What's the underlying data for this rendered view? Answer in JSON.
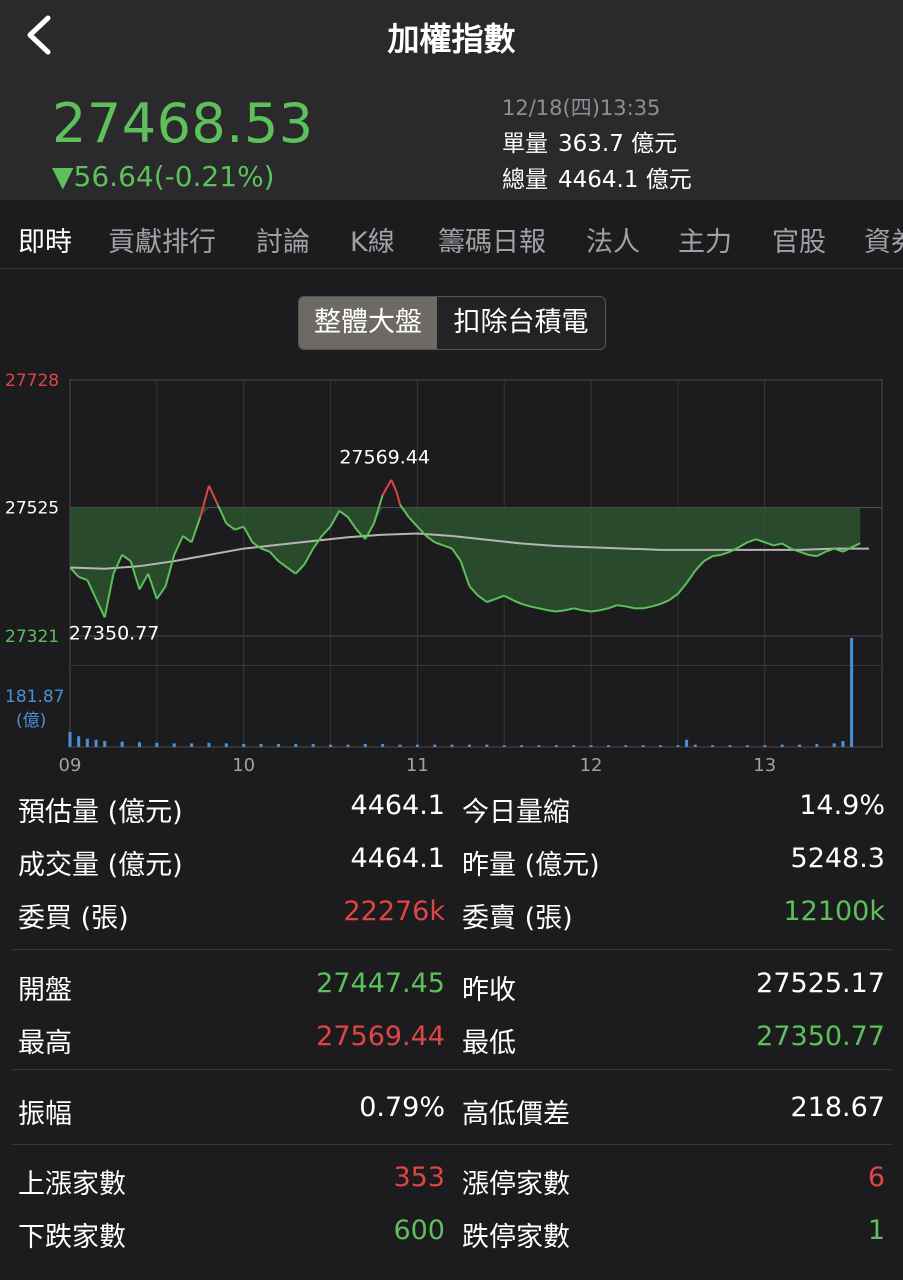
{
  "header": {
    "title": "加權指數",
    "price": "27468.53",
    "change": "▼56.64(-0.21%)",
    "datetime": "12/18(四)13:35",
    "single_volume_label": "單量",
    "single_volume_value": "363.7 億元",
    "total_volume_label": "總量",
    "total_volume_value": "4464.1 億元"
  },
  "tabs": [
    "即時",
    "貢獻排行",
    "討論",
    "K線",
    "籌碼日報",
    "法人",
    "主力",
    "官股",
    "資券"
  ],
  "segment": {
    "options": [
      "整體大盤",
      "扣除台積電"
    ],
    "selected": 0
  },
  "colors": {
    "up": "#e04545",
    "down": "#5dc05b",
    "volume": "#4a90d9",
    "avg": "#b5b5b5"
  },
  "chart_data": {
    "type": "line",
    "y_labels": {
      "top": "27728",
      "mid": "27525",
      "bottom": "27321"
    },
    "ylim": [
      27321,
      27728
    ],
    "prev_close": 27525.17,
    "high_annotation": "27569.44",
    "low_annotation": "27350.77",
    "volume_max_label": "181.87",
    "volume_unit": "(億)",
    "volume_max": 181.87,
    "x_ticks": [
      "09",
      "10",
      "11",
      "12",
      "13"
    ],
    "x_tick_hours": [
      9,
      10,
      11,
      12,
      13
    ],
    "series": [
      {
        "values": [
          [
            9.0,
            27430
          ],
          [
            9.05,
            27415
          ],
          [
            9.1,
            27410
          ],
          [
            9.15,
            27380
          ],
          [
            9.2,
            27350.77
          ],
          [
            9.25,
            27420
          ],
          [
            9.3,
            27450
          ],
          [
            9.35,
            27440
          ],
          [
            9.4,
            27395
          ],
          [
            9.45,
            27420
          ],
          [
            9.5,
            27380
          ],
          [
            9.55,
            27400
          ],
          [
            9.6,
            27450
          ],
          [
            9.65,
            27480
          ],
          [
            9.7,
            27470
          ],
          [
            9.75,
            27510
          ],
          [
            9.8,
            27560
          ],
          [
            9.85,
            27530
          ],
          [
            9.9,
            27500
          ],
          [
            9.95,
            27490
          ],
          [
            10.0,
            27495
          ],
          [
            10.05,
            27470
          ],
          [
            10.1,
            27460
          ],
          [
            10.15,
            27455
          ],
          [
            10.2,
            27440
          ],
          [
            10.25,
            27430
          ],
          [
            10.3,
            27420
          ],
          [
            10.35,
            27435
          ],
          [
            10.4,
            27460
          ],
          [
            10.45,
            27480
          ],
          [
            10.5,
            27495
          ],
          [
            10.55,
            27520
          ],
          [
            10.6,
            27510
          ],
          [
            10.65,
            27490
          ],
          [
            10.7,
            27475
          ],
          [
            10.75,
            27500
          ],
          [
            10.8,
            27545
          ],
          [
            10.85,
            27569.44
          ],
          [
            10.88,
            27550
          ],
          [
            10.9,
            27530
          ],
          [
            10.95,
            27510
          ],
          [
            11.0,
            27495
          ],
          [
            11.05,
            27480
          ],
          [
            11.1,
            27470
          ],
          [
            11.15,
            27465
          ],
          [
            11.2,
            27460
          ],
          [
            11.25,
            27440
          ],
          [
            11.3,
            27400
          ],
          [
            11.35,
            27385
          ],
          [
            11.4,
            27375
          ],
          [
            11.45,
            27380
          ],
          [
            11.5,
            27385
          ],
          [
            11.55,
            27378
          ],
          [
            11.6,
            27372
          ],
          [
            11.65,
            27368
          ],
          [
            11.7,
            27365
          ],
          [
            11.75,
            27362
          ],
          [
            11.8,
            27360
          ],
          [
            11.85,
            27362
          ],
          [
            11.9,
            27365
          ],
          [
            11.95,
            27362
          ],
          [
            12.0,
            27360
          ],
          [
            12.05,
            27362
          ],
          [
            12.1,
            27365
          ],
          [
            12.15,
            27370
          ],
          [
            12.2,
            27368
          ],
          [
            12.25,
            27365
          ],
          [
            12.3,
            27365
          ],
          [
            12.35,
            27368
          ],
          [
            12.4,
            27372
          ],
          [
            12.45,
            27378
          ],
          [
            12.5,
            27388
          ],
          [
            12.55,
            27405
          ],
          [
            12.6,
            27425
          ],
          [
            12.65,
            27440
          ],
          [
            12.7,
            27448
          ],
          [
            12.75,
            27450
          ],
          [
            12.8,
            27455
          ],
          [
            12.85,
            27462
          ],
          [
            12.9,
            27470
          ],
          [
            12.95,
            27475
          ],
          [
            13.0,
            27470
          ],
          [
            13.05,
            27465
          ],
          [
            13.1,
            27468
          ],
          [
            13.15,
            27460
          ],
          [
            13.2,
            27455
          ],
          [
            13.25,
            27450
          ],
          [
            13.3,
            27448
          ],
          [
            13.35,
            27455
          ],
          [
            13.4,
            27460
          ],
          [
            13.45,
            27455
          ],
          [
            13.5,
            27462
          ],
          [
            13.55,
            27468.53
          ]
        ]
      },
      {
        "values": [
          [
            9.0,
            27430
          ],
          [
            9.2,
            27428
          ],
          [
            9.4,
            27432
          ],
          [
            9.6,
            27440
          ],
          [
            9.8,
            27450
          ],
          [
            10.0,
            27460
          ],
          [
            10.2,
            27466
          ],
          [
            10.4,
            27472
          ],
          [
            10.6,
            27478
          ],
          [
            10.8,
            27482
          ],
          [
            11.0,
            27484
          ],
          [
            11.2,
            27480
          ],
          [
            11.4,
            27474
          ],
          [
            11.6,
            27468
          ],
          [
            11.8,
            27464
          ],
          [
            12.0,
            27462
          ],
          [
            12.2,
            27460
          ],
          [
            12.4,
            27458
          ],
          [
            12.6,
            27458
          ],
          [
            12.8,
            27458
          ],
          [
            13.0,
            27458
          ],
          [
            13.2,
            27458
          ],
          [
            13.4,
            27460
          ],
          [
            13.6,
            27460
          ]
        ]
      },
      {
        "values": [
          [
            9.0,
            25
          ],
          [
            9.05,
            18
          ],
          [
            9.1,
            14
          ],
          [
            9.15,
            12
          ],
          [
            9.2,
            10
          ],
          [
            9.3,
            9
          ],
          [
            9.4,
            8
          ],
          [
            9.5,
            7
          ],
          [
            9.6,
            6
          ],
          [
            9.7,
            6
          ],
          [
            9.8,
            7
          ],
          [
            9.9,
            6
          ],
          [
            10.0,
            5
          ],
          [
            10.1,
            5
          ],
          [
            10.2,
            5
          ],
          [
            10.3,
            5
          ],
          [
            10.4,
            5
          ],
          [
            10.5,
            4
          ],
          [
            10.6,
            4
          ],
          [
            10.7,
            5
          ],
          [
            10.8,
            5
          ],
          [
            10.9,
            4
          ],
          [
            11.0,
            4
          ],
          [
            11.1,
            4
          ],
          [
            11.2,
            4
          ],
          [
            11.3,
            4
          ],
          [
            11.4,
            4
          ],
          [
            11.5,
            3
          ],
          [
            11.6,
            3
          ],
          [
            11.7,
            3
          ],
          [
            11.8,
            3
          ],
          [
            11.9,
            3
          ],
          [
            12.0,
            3
          ],
          [
            12.1,
            3
          ],
          [
            12.2,
            3
          ],
          [
            12.3,
            3
          ],
          [
            12.4,
            3
          ],
          [
            12.5,
            3
          ],
          [
            12.55,
            12
          ],
          [
            12.6,
            4
          ],
          [
            12.7,
            3
          ],
          [
            12.8,
            3
          ],
          [
            12.9,
            3
          ],
          [
            13.0,
            3
          ],
          [
            13.1,
            4
          ],
          [
            13.2,
            4
          ],
          [
            13.3,
            5
          ],
          [
            13.4,
            6
          ],
          [
            13.45,
            10
          ],
          [
            13.5,
            181.87
          ]
        ]
      }
    ]
  },
  "stats": {
    "est_volume_label": "預估量 (億元)",
    "est_volume_value": "4464.1",
    "shrink_label": "今日量縮",
    "shrink_value": "14.9%",
    "deal_volume_label": "成交量 (億元)",
    "deal_volume_value": "4464.1",
    "yest_volume_label": "昨量 (億元)",
    "yest_volume_value": "5248.3",
    "bid_label": "委買 (張)",
    "bid_value": "22276k",
    "ask_label": "委賣 (張)",
    "ask_value": "12100k",
    "open_label": "開盤",
    "open_value": "27447.45",
    "prev_close_label": "昨收",
    "prev_close_value": "27525.17",
    "high_label": "最高",
    "high_value": "27569.44",
    "low_label": "最低",
    "low_value": "27350.77",
    "amplitude_label": "振幅",
    "amplitude_value": "0.79%",
    "spread_label": "高低價差",
    "spread_value": "218.67",
    "adv_label": "上漲家數",
    "adv_value": "353",
    "limit_up_label": "漲停家數",
    "limit_up_value": "6",
    "dec_label": "下跌家數",
    "dec_value": "600",
    "limit_down_label": "跌停家數",
    "limit_down_value": "1"
  }
}
